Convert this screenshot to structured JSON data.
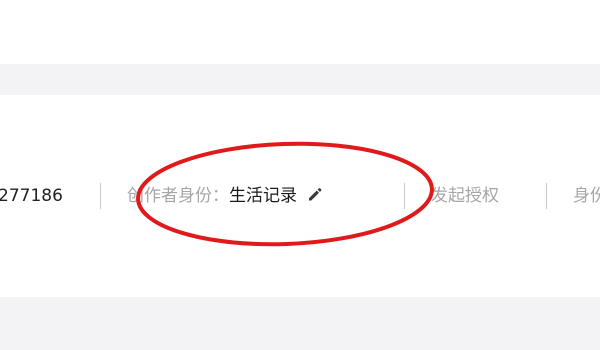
{
  "profile_bar": {
    "uid_value": "277186",
    "identity": {
      "label": "创作者身份：",
      "value": "生活记录",
      "edit_icon": "pencil-icon"
    },
    "auth_link": "发起授权",
    "cut_item": "身份"
  },
  "annotation": {
    "color": "#e0191b"
  }
}
